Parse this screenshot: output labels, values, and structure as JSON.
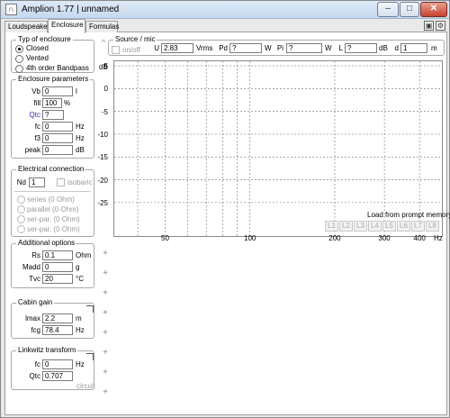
{
  "window": {
    "title": "Amplion 1.77 | unnamed",
    "app_icon": "amplion-app-icon"
  },
  "tabs": [
    "Loudspeaker",
    "Enclosure",
    "Formulas"
  ],
  "active_tab": "Enclosure",
  "enclosure_type": {
    "legend": "Typ of enclosure",
    "options": [
      "Closed",
      "Vented",
      "4th order Bandpass"
    ],
    "selected": "Closed"
  },
  "enclosure_params": {
    "legend": "Enclosure parameters",
    "vb": {
      "label": "Vb",
      "value": "0",
      "unit": "l"
    },
    "fill": {
      "label": "fill",
      "value": "100",
      "unit": "%"
    },
    "qtc": {
      "label": "Qtc",
      "value": "?"
    },
    "fc": {
      "label": "fc",
      "value": "0",
      "unit": "Hz"
    },
    "f3": {
      "label": "f3",
      "value": "0",
      "unit": "Hz"
    },
    "peak": {
      "label": "peak",
      "value": "0",
      "unit": "dB"
    }
  },
  "electrical": {
    "legend": "Electrical connection",
    "nd": {
      "label": "Nd",
      "value": "1"
    },
    "isobaric_label": "isobaric",
    "options": [
      "series (0 Ohm)",
      "parallel (0 Ohm)",
      "ser-par. (0 Ohm)",
      "ser-par. (0 Ohm)"
    ]
  },
  "additional": {
    "legend": "Additional options",
    "rs": {
      "label": "Rs",
      "value": "0.1",
      "unit": "Ohm"
    },
    "madd": {
      "label": "Madd",
      "value": "0",
      "unit": "g"
    },
    "tvc": {
      "label": "Tvc",
      "value": "20",
      "unit": "°C"
    }
  },
  "cabin_gain": {
    "legend": "Cabin gain",
    "lmax": {
      "label": "lmax",
      "value": "2.2",
      "unit": "m"
    },
    "fcg": {
      "label": "fcg",
      "value": "78.4",
      "unit": "Hz"
    }
  },
  "linkwitz": {
    "legend": "Linkwitz transform",
    "fc": {
      "label": "fc",
      "value": "0",
      "unit": "Hz"
    },
    "qtc": {
      "label": "Qtc",
      "value": "0.707"
    },
    "circuit_label": "circuit"
  },
  "source": {
    "legend": "Source / mic",
    "onoff_label": "on/off",
    "u": {
      "label": "U",
      "value": "2.83",
      "unit": "Vrms"
    },
    "pd": {
      "label": "Pd",
      "value": "?",
      "unit": "W"
    },
    "pi": {
      "label": "Pi",
      "value": "?",
      "unit": "W"
    },
    "l": {
      "label": "L",
      "value": "?",
      "unit": "dB"
    },
    "d": {
      "label": "d",
      "value": "1",
      "unit": "m"
    }
  },
  "chart": {
    "ylabel": "dB",
    "xlabel": "Hz",
    "load_memory_label": "Load from prompt memory",
    "memory_slots": [
      "L1",
      "L2",
      "L3",
      "L4",
      "L5",
      "L6",
      "L7",
      "L8"
    ]
  },
  "chart_data": {
    "type": "line",
    "xscale": "log",
    "xlim": [
      33,
      480
    ],
    "ylim": [
      -28,
      6
    ],
    "yticks": [
      5,
      0,
      -5,
      -10,
      -15,
      -20,
      -25
    ],
    "xticks": [
      50,
      100,
      200,
      300,
      400
    ],
    "grid": true,
    "series": []
  },
  "colors": {
    "selected_field": "#3a6fd8",
    "qtc_label": "#2a2aa8"
  }
}
